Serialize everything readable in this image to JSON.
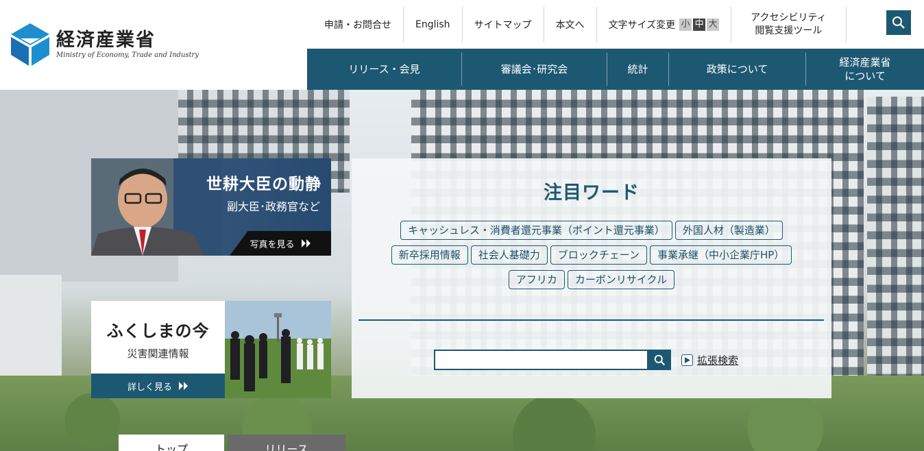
{
  "brand": {
    "name_jp": "経済産業省",
    "name_en": "Ministry of Economy, Trade and Industry",
    "color": "#1d5872"
  },
  "utility_nav": {
    "apply": "申請・お問合せ",
    "english": "English",
    "sitemap": "サイトマップ",
    "skip": "本文へ",
    "font_size_label": "文字サイズ変更",
    "font_small": "小",
    "font_medium": "中",
    "font_large": "大",
    "accessibility_line1": "アクセシビリティ",
    "accessibility_line2": "閲覧支援ツール",
    "search_icon": "search-icon"
  },
  "global_nav": [
    {
      "label": "リリース・会見"
    },
    {
      "label": "審議会･研究会"
    },
    {
      "label": "統計"
    },
    {
      "label": "政策について"
    },
    {
      "label_line1": "経済産業省",
      "label_line2": "について"
    }
  ],
  "minister_card": {
    "title": "世耕大臣の動静",
    "subtitle": "副大臣･政務官など",
    "more": "写真を見る"
  },
  "fukushima_card": {
    "title": "ふくしまの今",
    "subtitle": "災害関連情報",
    "more": "詳しく見る"
  },
  "keywords": {
    "title": "注目ワード",
    "tags": [
      "キャッシュレス・消費者還元事業（ポイント還元事業）",
      "外国人材（製造業）",
      "新卒採用情報",
      "社会人基礎力",
      "ブロックチェーン",
      "事業承継（中小企業庁HP）",
      "アフリカ",
      "カーボンリサイクル"
    ]
  },
  "search": {
    "value": "",
    "advanced_label": "拡張検索"
  },
  "tabs": {
    "top": "トップ",
    "release": "リリース"
  }
}
